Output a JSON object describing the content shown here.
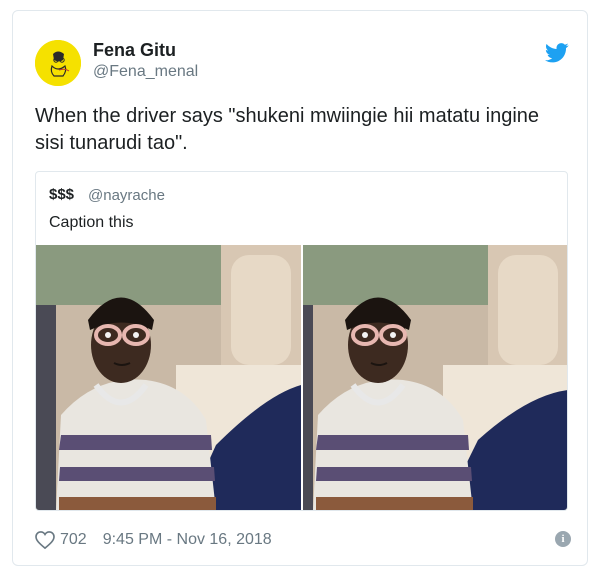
{
  "tweet": {
    "author_name": "Fena Gitu",
    "author_handle": "@Fena_menal",
    "text": "When the driver says \"shukeni mwiingie hii matatu ingine sisi tunarudi tao\".",
    "likes": "702",
    "timestamp": "9:45 PM - Nov 16, 2018"
  },
  "quoted": {
    "author_name": "$$$",
    "author_handle": "@nayrache",
    "text": "Caption this"
  },
  "icons": {
    "brand": "twitter-bird-icon",
    "like": "heart-icon",
    "info": "info-icon"
  },
  "colors": {
    "brand_blue": "#1da1f2",
    "secondary_text": "#697882",
    "avatar_bg": "#f5e100"
  }
}
